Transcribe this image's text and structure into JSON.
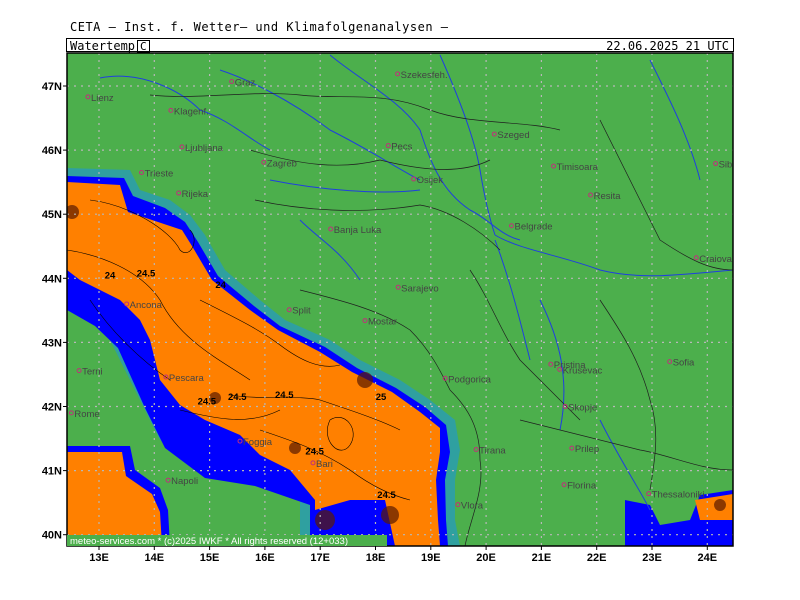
{
  "header": {
    "title": "CETA – Inst. f. Wetter– und Klimafolgenanalysen –"
  },
  "panel": {
    "field": "Watertemp",
    "unit": "C",
    "datetime": "22.06.2025 21 UTC"
  },
  "lat_labels": [
    "47N",
    "46N",
    "45N",
    "44N",
    "43N",
    "42N",
    "41N",
    "40N"
  ],
  "lon_labels": [
    "13E",
    "14E",
    "15E",
    "16E",
    "17E",
    "18E",
    "19E",
    "20E",
    "21E",
    "22E",
    "23E",
    "24E"
  ],
  "cities": [
    {
      "name": "Graz",
      "lon": 15.4,
      "lat": 47.07
    },
    {
      "name": "Szekesfeh.",
      "lon": 18.4,
      "lat": 47.19
    },
    {
      "name": "Lienz",
      "lon": 12.8,
      "lat": 46.83
    },
    {
      "name": "Klagenf.",
      "lon": 14.3,
      "lat": 46.62
    },
    {
      "name": "Szeged",
      "lon": 20.15,
      "lat": 46.25
    },
    {
      "name": "Ljubljana",
      "lon": 14.5,
      "lat": 46.05
    },
    {
      "name": "Pecs",
      "lon": 18.23,
      "lat": 46.07
    },
    {
      "name": "Zagreb",
      "lon": 15.98,
      "lat": 45.81
    },
    {
      "name": "Timisoara",
      "lon": 21.22,
      "lat": 45.75
    },
    {
      "name": "Sibiu",
      "lon": 24.15,
      "lat": 45.79
    },
    {
      "name": "Trieste",
      "lon": 13.77,
      "lat": 45.65
    },
    {
      "name": "Osijek",
      "lon": 18.69,
      "lat": 45.55
    },
    {
      "name": "Rijeka",
      "lon": 14.44,
      "lat": 45.33
    },
    {
      "name": "Resita",
      "lon": 21.89,
      "lat": 45.3
    },
    {
      "name": "Banja Luka",
      "lon": 17.19,
      "lat": 44.77
    },
    {
      "name": "Belgrade",
      "lon": 20.46,
      "lat": 44.82
    },
    {
      "name": "Craiova",
      "lon": 23.8,
      "lat": 44.32
    },
    {
      "name": "Sarajevo",
      "lon": 18.41,
      "lat": 43.86
    },
    {
      "name": "Ancona",
      "lon": 13.5,
      "lat": 43.6
    },
    {
      "name": "Split",
      "lon": 16.44,
      "lat": 43.51
    },
    {
      "name": "Mostar",
      "lon": 17.81,
      "lat": 43.34
    },
    {
      "name": "Terni",
      "lon": 12.64,
      "lat": 42.56
    },
    {
      "name": "Pristina",
      "lon": 21.17,
      "lat": 42.66
    },
    {
      "name": "Sofia",
      "lon": 23.32,
      "lat": 42.7
    },
    {
      "name": "Krusevac",
      "lon": 21.33,
      "lat": 42.58
    },
    {
      "name": "Pescara",
      "lon": 14.21,
      "lat": 42.46
    },
    {
      "name": "Podgorica",
      "lon": 19.26,
      "lat": 42.44
    },
    {
      "name": "Rome",
      "lon": 12.5,
      "lat": 41.9
    },
    {
      "name": "Skopje",
      "lon": 21.43,
      "lat": 42.0
    },
    {
      "name": "Foggia",
      "lon": 15.55,
      "lat": 41.46
    },
    {
      "name": "Tirana",
      "lon": 19.82,
      "lat": 41.33
    },
    {
      "name": "Prilep",
      "lon": 21.55,
      "lat": 41.35
    },
    {
      "name": "Bari",
      "lon": 16.87,
      "lat": 41.12
    },
    {
      "name": "Napoli",
      "lon": 14.25,
      "lat": 40.85
    },
    {
      "name": "Florina",
      "lon": 21.41,
      "lat": 40.78
    },
    {
      "name": "Thessaloniki",
      "lon": 22.94,
      "lat": 40.64
    },
    {
      "name": "Vlora",
      "lon": 19.49,
      "lat": 40.47
    }
  ],
  "isotherm_labels": [
    {
      "text": "24",
      "lon": 13.2,
      "lat": 44.0
    },
    {
      "text": "24.5",
      "lon": 13.85,
      "lat": 44.03
    },
    {
      "text": "24",
      "lon": 15.2,
      "lat": 43.85
    },
    {
      "text": "24.5",
      "lon": 15.5,
      "lat": 42.1
    },
    {
      "text": "24.5",
      "lon": 14.95,
      "lat": 42.03
    },
    {
      "text": "24.5",
      "lon": 16.35,
      "lat": 42.13
    },
    {
      "text": "25",
      "lon": 18.1,
      "lat": 42.1
    },
    {
      "text": "24.5",
      "lon": 16.9,
      "lat": 41.25
    },
    {
      "text": "24.5",
      "lon": 18.2,
      "lat": 40.57
    }
  ],
  "copyright": "meteo-services.com * (c)2025 IWKF * All rights reserved (12+033)",
  "colors": {
    "land": "#4caf4c",
    "sea_warm": "#ff8000",
    "coast_blue": "#0000ff",
    "coast_teal": "#2fa0a0",
    "rivers": "#1f3fdf",
    "grid": "#b8b8b8"
  }
}
